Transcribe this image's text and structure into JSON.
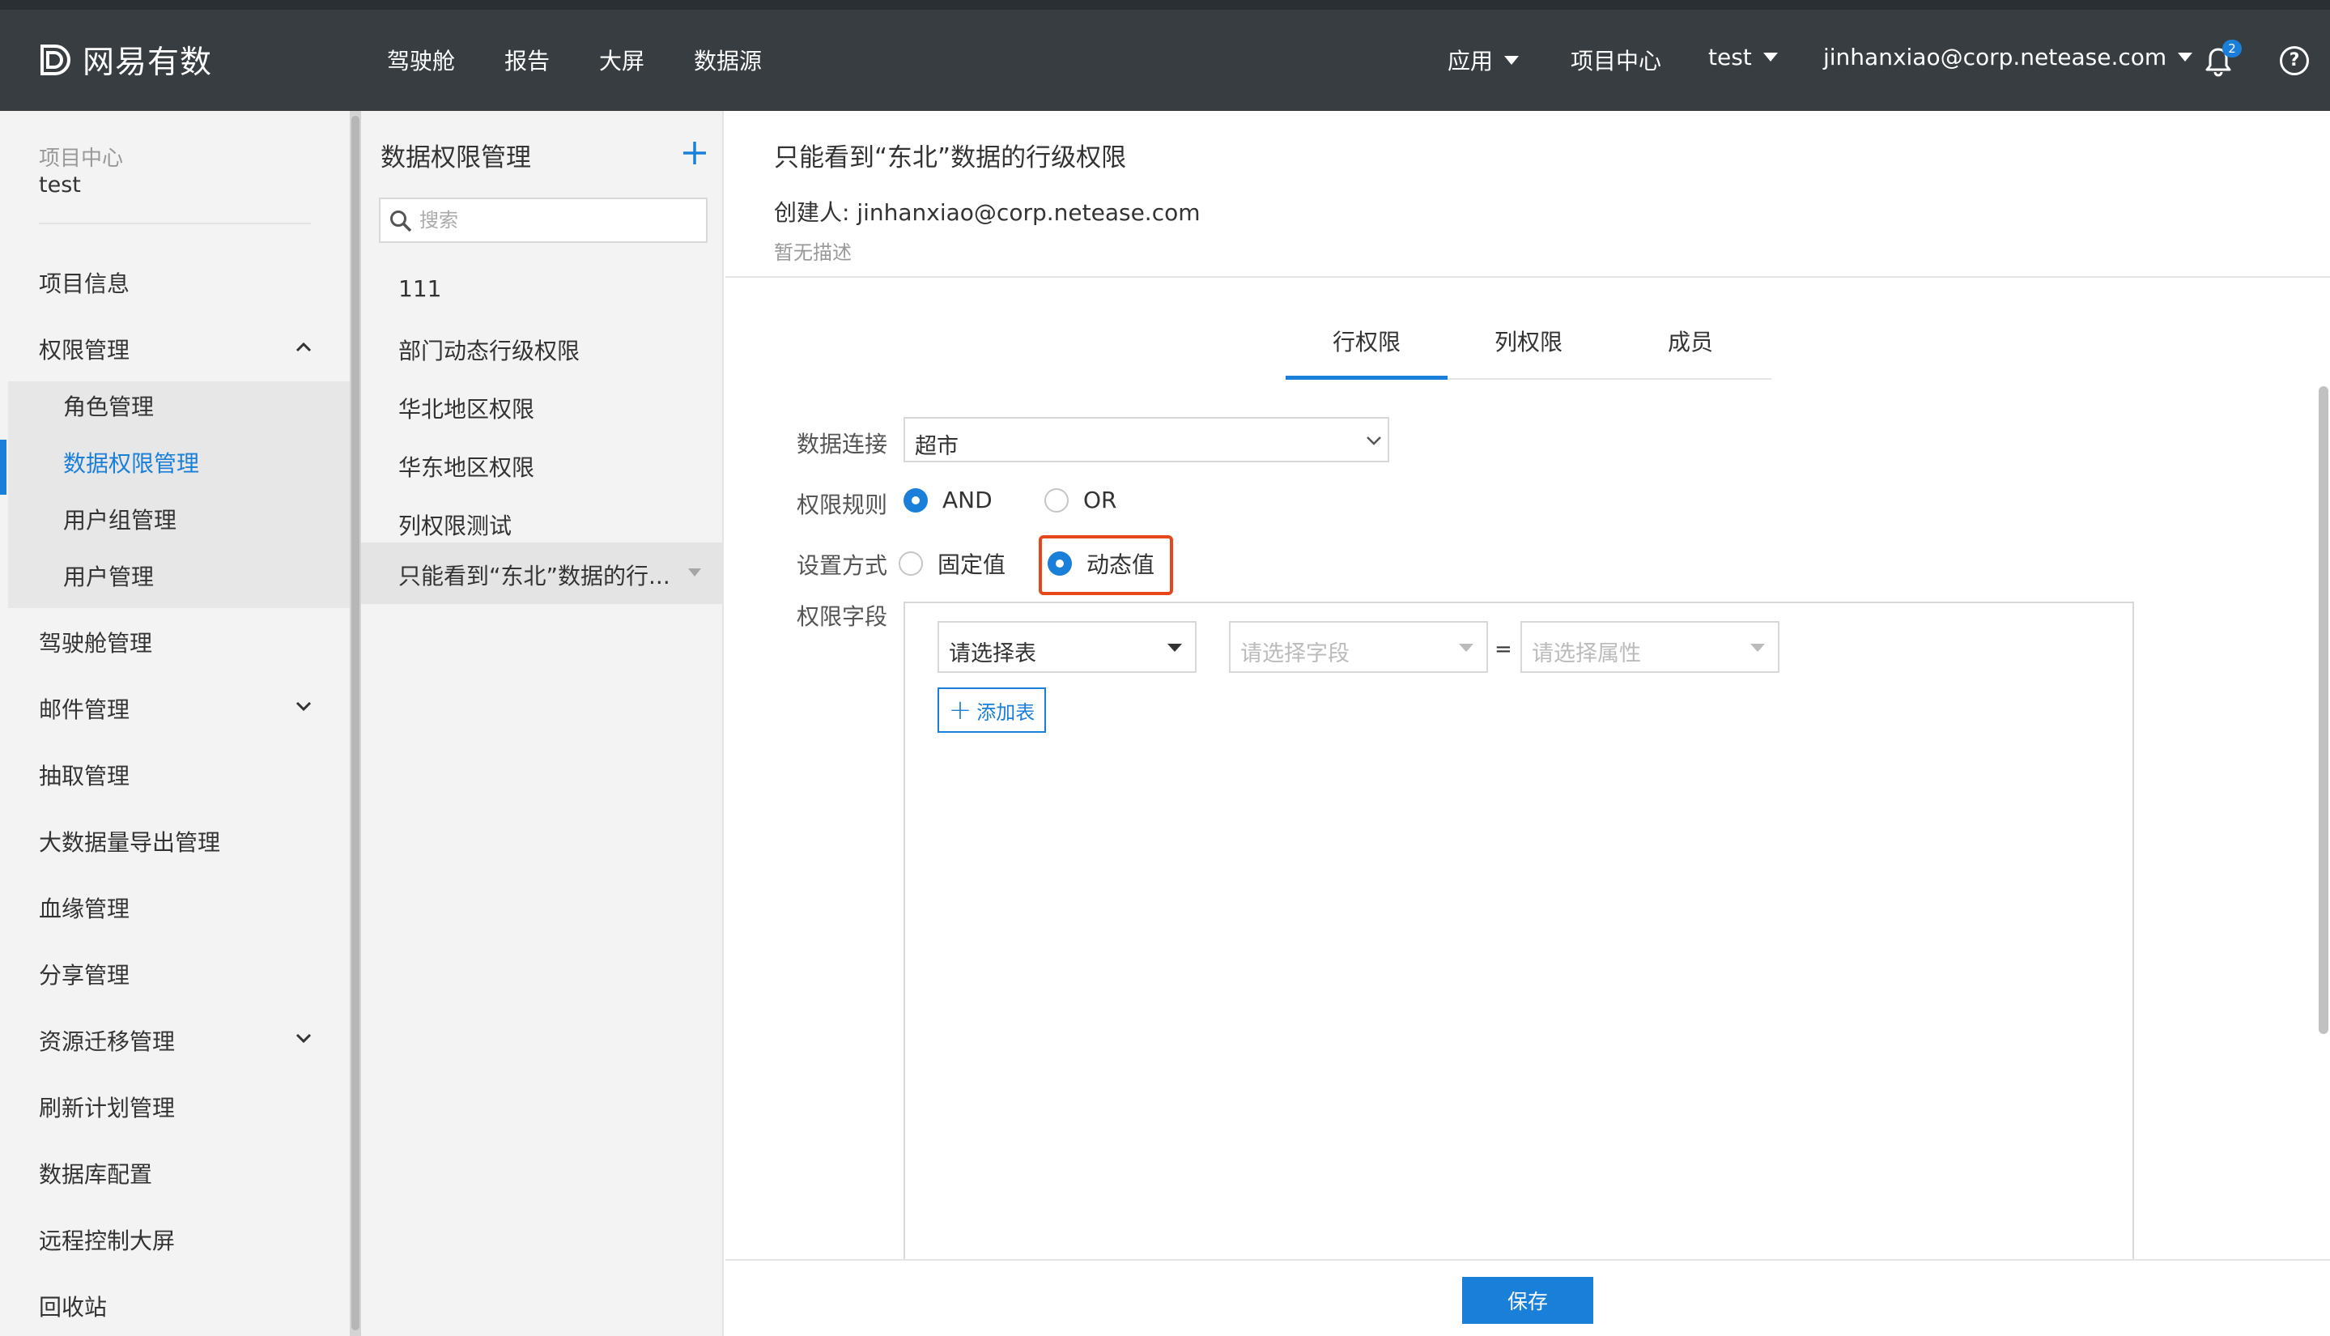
{
  "header": {
    "logo_text": "网易有数",
    "nav": [
      "驾驶舱",
      "报告",
      "大屏",
      "数据源"
    ],
    "apps_label": "应用",
    "project_center": "项目中心",
    "project_name": "test",
    "user_email": "jinhanxiao@corp.netease.com",
    "notification_count": "2",
    "help_symbol": "?"
  },
  "sidebar": {
    "caption": "项目中心",
    "project": "test",
    "items": {
      "project_info": "项目信息",
      "permission_mgmt": "权限管理",
      "cockpit_mgmt": "驾驶舱管理",
      "mail_mgmt": "邮件管理",
      "extract_mgmt": "抽取管理",
      "bigdata_export": "大数据量导出管理",
      "lineage_mgmt": "血缘管理",
      "share_mgmt": "分享管理",
      "migration_mgmt": "资源迁移管理",
      "refresh_plan": "刷新计划管理",
      "db_config": "数据库配置",
      "remote_screen": "远程控制大屏",
      "recycle_bin": "回收站"
    },
    "sub_items": {
      "role_mgmt": "角色管理",
      "data_perm_mgmt": "数据权限管理",
      "usergroup_mgmt": "用户组管理",
      "user_mgmt": "用户管理"
    }
  },
  "list_panel": {
    "title": "数据权限管理",
    "search_placeholder": "搜索",
    "items": [
      "111",
      "部门动态行级权限",
      "华北地区权限",
      "华东地区权限",
      "列权限测试"
    ],
    "active_item": "只能看到“东北”数据的行..."
  },
  "detail": {
    "title": "只能看到“东北”数据的行级权限",
    "creator": "创建人: jinhanxiao@corp.netease.com",
    "description": "暂无描述",
    "tabs": [
      "行权限",
      "列权限",
      "成员"
    ],
    "active_tab": "行权限",
    "form": {
      "data_connection_label": "数据连接",
      "data_connection_value": "超市",
      "rule_label": "权限规则",
      "rule_and": "AND",
      "rule_or": "OR",
      "rule_selected": "AND",
      "mode_label": "设置方式",
      "mode_fixed": "固定值",
      "mode_dynamic": "动态值",
      "mode_selected": "动态值",
      "field_label": "权限字段",
      "table_select": "请选择表",
      "field_select_placeholder": "请选择字段",
      "equals": "=",
      "attr_select_placeholder": "请选择属性",
      "add_table": "添加表"
    },
    "save_button": "保存"
  },
  "colors": {
    "topbar": "#373d41",
    "accent": "#1a7fd9",
    "highlight": "#e64619"
  }
}
